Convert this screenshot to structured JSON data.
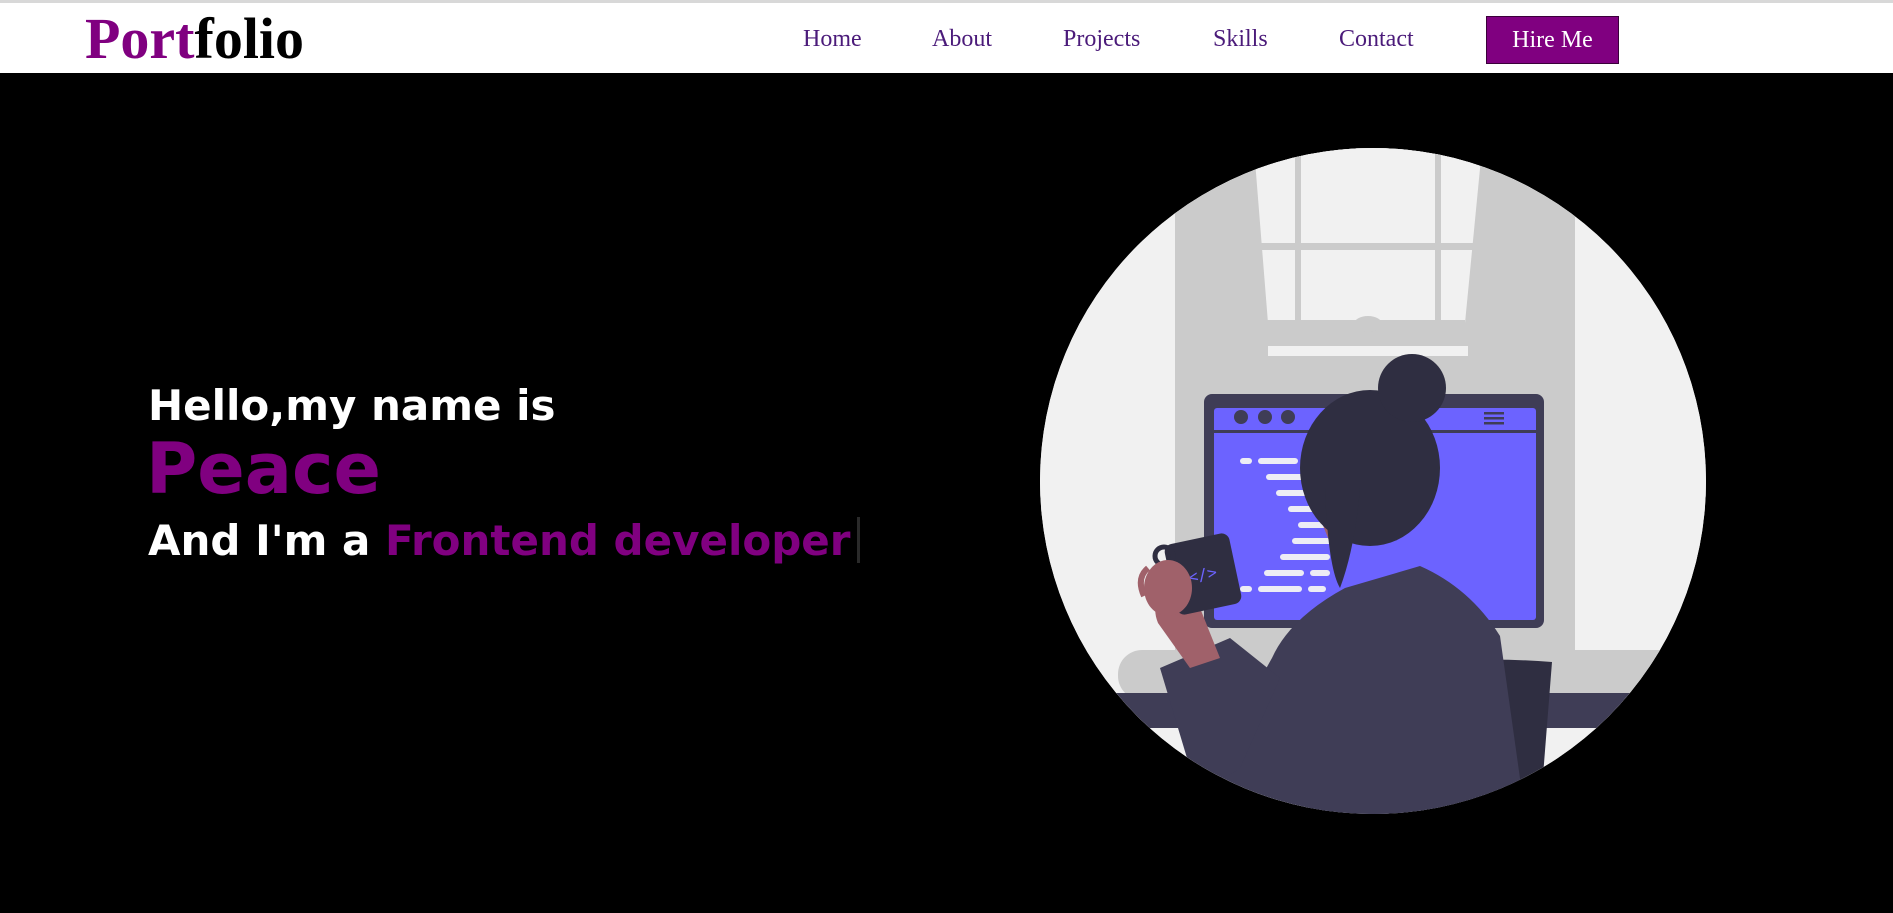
{
  "nav": {
    "logo_accent": "Port",
    "logo_rest": "folio",
    "links": [
      {
        "label": "Home"
      },
      {
        "label": "About"
      },
      {
        "label": "Projects"
      },
      {
        "label": "Skills"
      },
      {
        "label": "Contact"
      }
    ],
    "cta_label": "Hire Me"
  },
  "hero": {
    "greeting": "Hello,my name is",
    "name": "Peace",
    "role_prefix": "And I'm a ",
    "role": "Frontend developer",
    "illustration_icon": "developer-at-desk-illustration"
  },
  "colors": {
    "accent": "#800080",
    "nav_link": "#4b1b7a",
    "background": "#000000",
    "monitor": "#6c63ff"
  }
}
